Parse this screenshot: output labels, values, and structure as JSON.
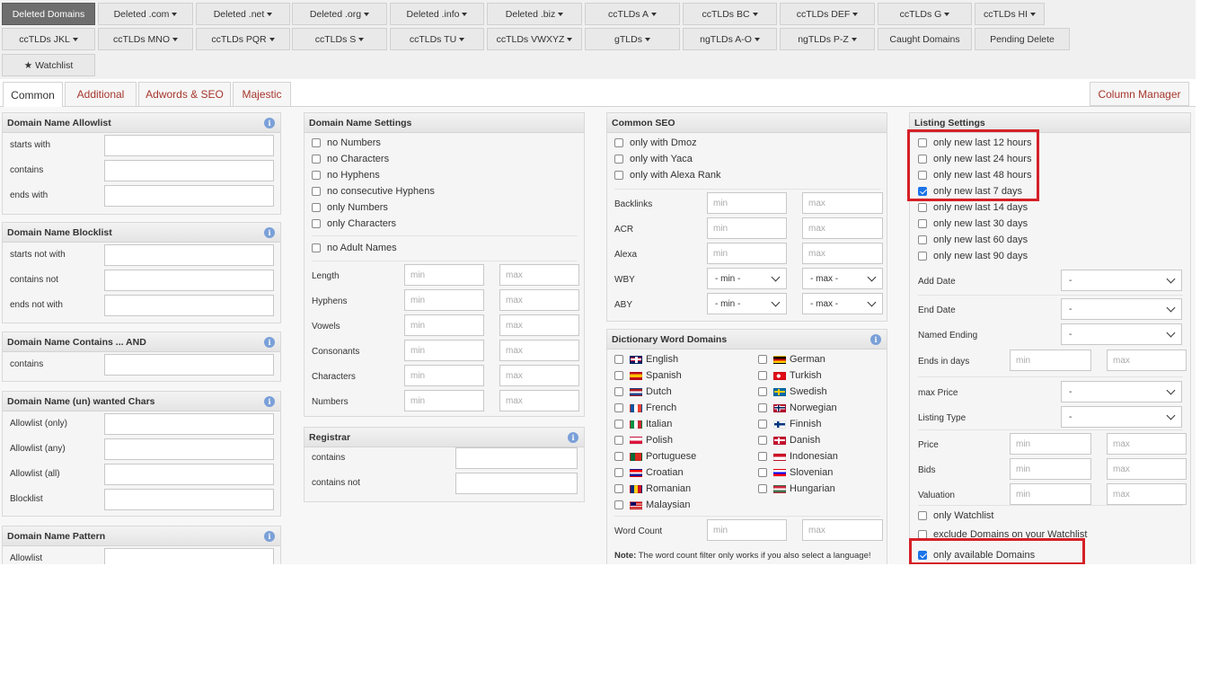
{
  "nav": {
    "row1": [
      {
        "label": "Deleted Domains",
        "active": true,
        "caret": false
      },
      {
        "label": "Deleted .com",
        "caret": true
      },
      {
        "label": "Deleted .net",
        "caret": true
      },
      {
        "label": "Deleted .org",
        "caret": true
      },
      {
        "label": "Deleted .info",
        "caret": true
      },
      {
        "label": "Deleted .biz",
        "caret": true
      },
      {
        "label": "ccTLDs A",
        "caret": true
      },
      {
        "label": "ccTLDs BC",
        "caret": true
      },
      {
        "label": "ccTLDs DEF",
        "caret": true
      },
      {
        "label": "ccTLDs G",
        "caret": true
      },
      {
        "label": "ccTLDs HI",
        "caret": true
      }
    ],
    "row2": [
      {
        "label": "ccTLDs JKL",
        "caret": true
      },
      {
        "label": "ccTLDs MNO",
        "caret": true
      },
      {
        "label": "ccTLDs PQR",
        "caret": true
      },
      {
        "label": "ccTLDs S",
        "caret": true
      },
      {
        "label": "ccTLDs TU",
        "caret": true
      },
      {
        "label": "ccTLDs VWXYZ",
        "caret": true
      },
      {
        "label": "gTLDs",
        "caret": true
      },
      {
        "label": "ngTLDs A-O",
        "caret": true
      },
      {
        "label": "ngTLDs P-Z",
        "caret": true
      },
      {
        "label": "Caught Domains",
        "caret": false
      },
      {
        "label": "Pending Delete",
        "caret": false
      }
    ],
    "watchlist": "★ Watchlist"
  },
  "tabs": [
    "Common",
    "Additional",
    "Adwords & SEO",
    "Majestic"
  ],
  "column_manager": "Column Manager",
  "allowlist": {
    "title": "Domain Name Allowlist",
    "rows": [
      "starts with",
      "contains",
      "ends with"
    ]
  },
  "blocklist": {
    "title": "Domain Name Blocklist",
    "rows": [
      "starts not with",
      "contains not",
      "ends not with"
    ]
  },
  "contains_and": {
    "title": "Domain Name Contains ... AND",
    "rows": [
      "contains"
    ]
  },
  "wanted_chars": {
    "title": "Domain Name (un) wanted Chars",
    "rows": [
      "Allowlist (only)",
      "Allowlist (any)",
      "Allowlist (all)",
      "Blocklist"
    ]
  },
  "pattern": {
    "title": "Domain Name Pattern",
    "rows": [
      "Allowlist"
    ]
  },
  "name_settings": {
    "title": "Domain Name Settings",
    "checks": [
      "no Numbers",
      "no Characters",
      "no Hyphens",
      "no consecutive Hyphens",
      "only Numbers",
      "only Characters"
    ],
    "adult": "no Adult Names",
    "ranges": [
      "Length",
      "Hyphens",
      "Vowels",
      "Consonants",
      "Characters",
      "Numbers"
    ],
    "min_ph": "min",
    "max_ph": "max"
  },
  "registrar": {
    "title": "Registrar",
    "rows": [
      "contains",
      "contains not"
    ]
  },
  "common_seo": {
    "title": "Common SEO",
    "checks": [
      "only with Dmoz",
      "only with Yaca",
      "only with Alexa Rank"
    ],
    "ranges": [
      "Backlinks",
      "ACR",
      "Alexa"
    ],
    "selects": [
      {
        "label": "WBY",
        "min": "- min -",
        "max": "- max -"
      },
      {
        "label": "ABY",
        "min": "- min -",
        "max": "- max -"
      }
    ]
  },
  "dictionary": {
    "title": "Dictionary Word Domains",
    "left": [
      {
        "name": "English",
        "flag": "gb"
      },
      {
        "name": "Spanish",
        "flag": "es"
      },
      {
        "name": "Dutch",
        "flag": "nl"
      },
      {
        "name": "French",
        "flag": "fr"
      },
      {
        "name": "Italian",
        "flag": "it"
      },
      {
        "name": "Polish",
        "flag": "pl"
      },
      {
        "name": "Portuguese",
        "flag": "pt"
      },
      {
        "name": "Croatian",
        "flag": "hr"
      },
      {
        "name": "Romanian",
        "flag": "ro"
      },
      {
        "name": "Malaysian",
        "flag": "my"
      }
    ],
    "right": [
      {
        "name": "German",
        "flag": "de"
      },
      {
        "name": "Turkish",
        "flag": "tr"
      },
      {
        "name": "Swedish",
        "flag": "se"
      },
      {
        "name": "Norwegian",
        "flag": "no"
      },
      {
        "name": "Finnish",
        "flag": "fi"
      },
      {
        "name": "Danish",
        "flag": "dk"
      },
      {
        "name": "Indonesian",
        "flag": "id"
      },
      {
        "name": "Slovenian",
        "flag": "si"
      },
      {
        "name": "Hungarian",
        "flag": "hu"
      }
    ],
    "word_count": "Word Count",
    "note_bold": "Note:",
    "note_text": " The word count filter only works if you also select a language!"
  },
  "listing": {
    "title": "Listing Settings",
    "periods": [
      {
        "label": "only new last 12 hours",
        "checked": false
      },
      {
        "label": "only new last 24 hours",
        "checked": false
      },
      {
        "label": "only new last 48 hours",
        "checked": false
      },
      {
        "label": "only new last 7 days",
        "checked": true
      },
      {
        "label": "only new last 14 days",
        "checked": false
      },
      {
        "label": "only new last 30 days",
        "checked": false
      },
      {
        "label": "only new last 60 days",
        "checked": false
      },
      {
        "label": "only new last 90 days",
        "checked": false
      }
    ],
    "add_date": "Add Date",
    "end_date": "End Date",
    "named_ending": "Named Ending",
    "ends_in_days": "Ends in days",
    "max_price": "max Price",
    "listing_type": "Listing Type",
    "select_value": "-",
    "price": "Price",
    "bids": "Bids",
    "valuation": "Valuation",
    "only_watchlist": "only Watchlist",
    "exclude_watchlist": "exclude Domains on your Watchlist",
    "only_available": "only available Domains",
    "only_available_checked": true
  },
  "colors": {
    "active_nav": "#6e6e6e",
    "tab_text": "#a6362d",
    "highlight": "#d52027",
    "checkbox": "#1a73e8"
  }
}
